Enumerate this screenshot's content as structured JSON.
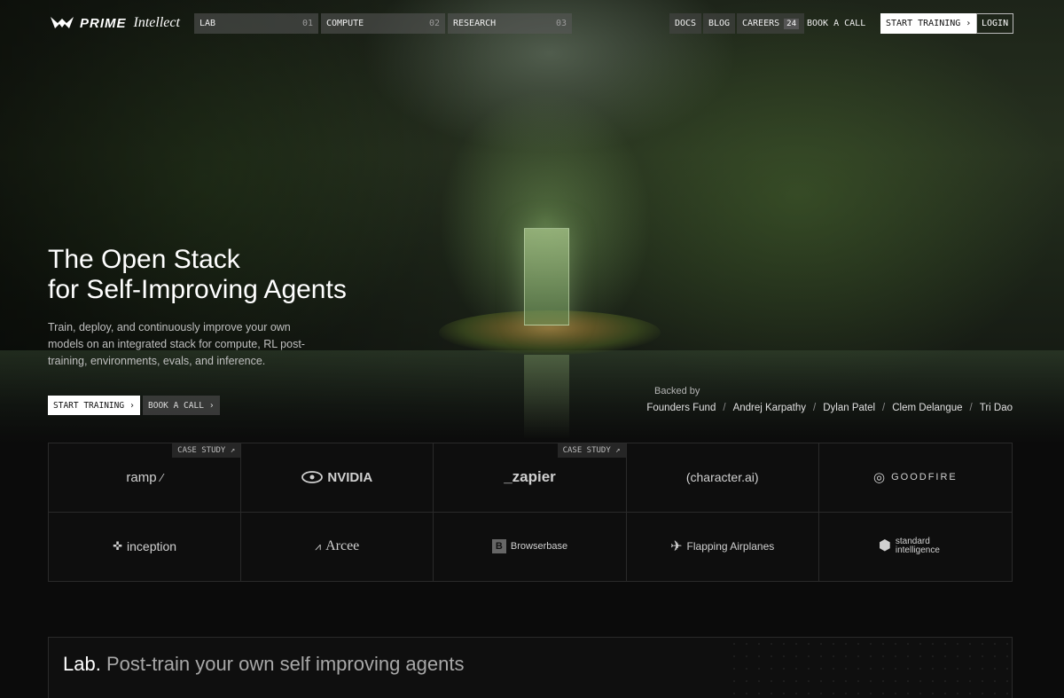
{
  "brand": {
    "name_bold": "PRIME",
    "name_script": "Intellect"
  },
  "nav": {
    "tabs": [
      {
        "label": "LAB",
        "num": "01"
      },
      {
        "label": "COMPUTE",
        "num": "02"
      },
      {
        "label": "RESEARCH",
        "num": "03"
      }
    ],
    "docs": "DOCS",
    "blog": "BLOG",
    "careers": "CAREERS",
    "careers_count": "24",
    "book_call": "BOOK A CALL",
    "start_training": "START TRAINING",
    "login": "LOGIN"
  },
  "hero": {
    "headline_line1": "The Open Stack",
    "headline_line2": "for Self-Improving Agents",
    "subtext": "Train, deploy, and continuously improve your own models on an integrated stack for compute, RL post-training, environments, evals, and inference.",
    "cta_primary": "START TRAINING",
    "cta_secondary": "BOOK A CALL",
    "backed_label": "Backed by",
    "backers": [
      "Founders Fund",
      "Andrej Karpathy",
      "Dylan Patel",
      "Clem Delangue",
      "Tri Dao"
    ]
  },
  "customers": {
    "case_study_label": "CASE STUDY",
    "logos": [
      "ramp",
      "NVIDIA",
      "zapier",
      "(character.ai)",
      "GOODFIRE",
      "inception",
      "Arcee",
      "Browserbase",
      "Flapping Airplanes",
      "standard intelligence"
    ]
  },
  "lab": {
    "title": "Lab.",
    "subtitle": "Post-train your own self improving agents"
  }
}
